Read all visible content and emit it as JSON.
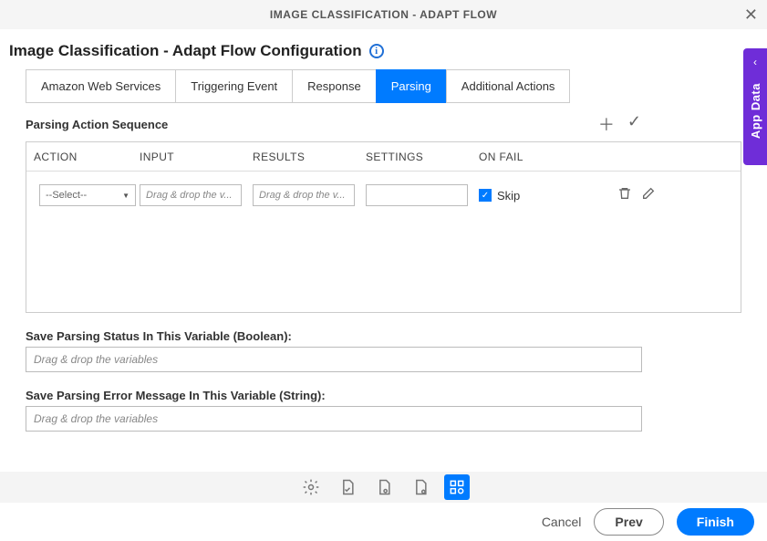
{
  "titlebar": {
    "title": "IMAGE CLASSIFICATION - ADAPT FLOW"
  },
  "header": {
    "title": "Image Classification - Adapt Flow Configuration"
  },
  "tabs": [
    "Amazon Web Services",
    "Triggering Event",
    "Response",
    "Parsing",
    "Additional Actions"
  ],
  "section": {
    "label": "Parsing Action Sequence",
    "columns": [
      "ACTION",
      "INPUT",
      "RESULTS",
      "SETTINGS",
      "ON FAIL"
    ],
    "row": {
      "select_placeholder": "--Select--",
      "input_placeholder": "Drag & drop the v...",
      "results_placeholder": "Drag & drop the v...",
      "skip_label": "Skip"
    }
  },
  "fields": {
    "status_label": "Save Parsing Status In This Variable (Boolean):",
    "status_placeholder": "Drag & drop the variables",
    "error_label": "Save Parsing Error Message In This Variable (String):",
    "error_placeholder": "Drag & drop the variables"
  },
  "footer": {
    "cancel": "Cancel",
    "prev": "Prev",
    "finish": "Finish"
  },
  "sidetab": {
    "label": "App Data"
  }
}
